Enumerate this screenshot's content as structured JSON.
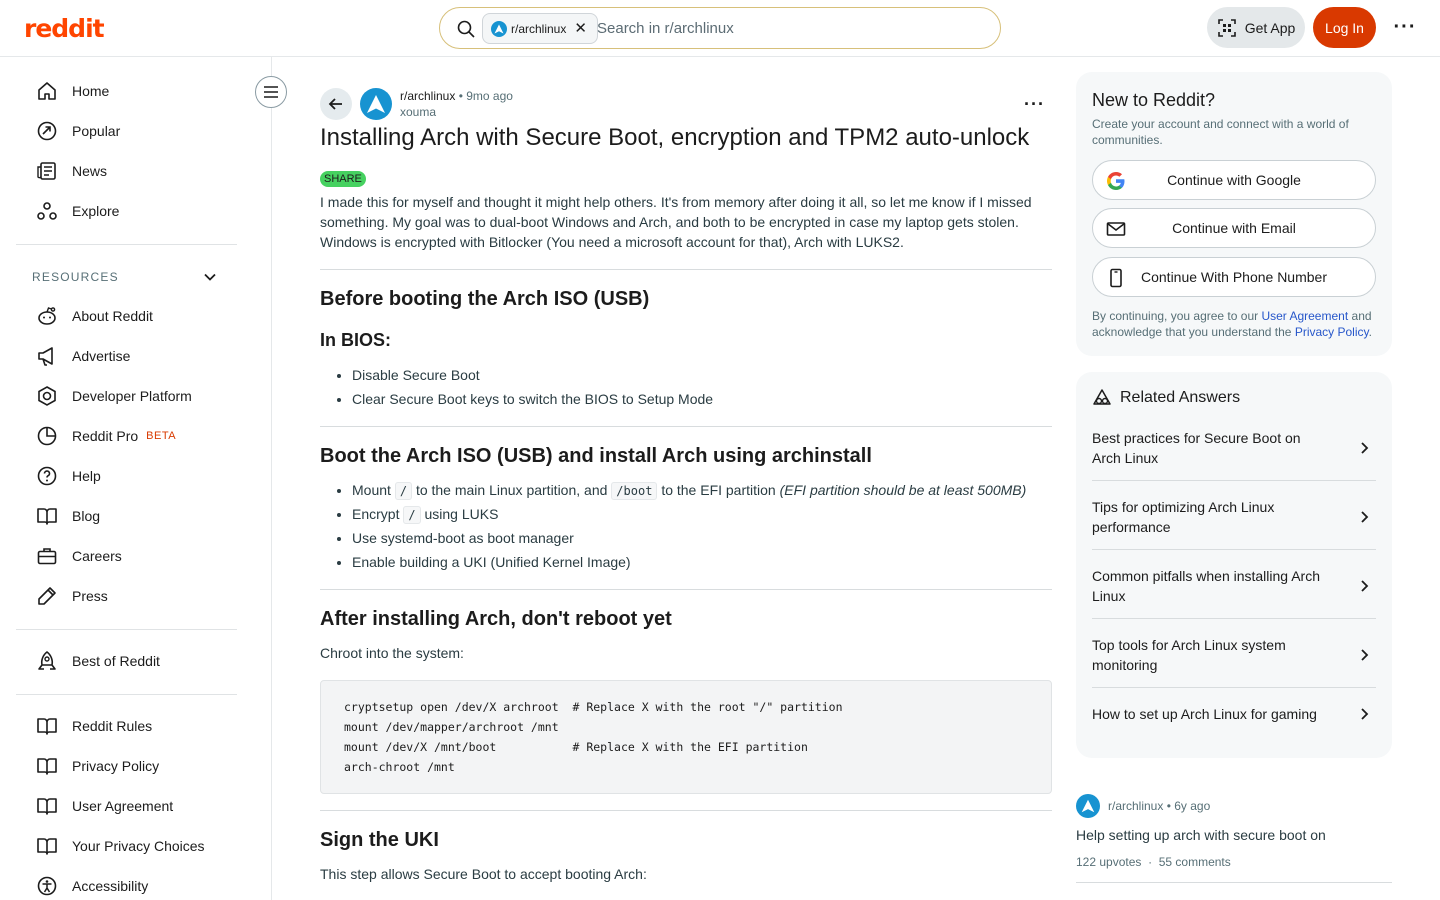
{
  "header": {
    "logo_text": "reddit",
    "search_chip": "r/archlinux",
    "search_placeholder": "Search in r/archlinux",
    "get_app": "Get App",
    "login": "Log In"
  },
  "sidebar": {
    "primary": [
      {
        "label": "Home",
        "icon": "home-icon"
      },
      {
        "label": "Popular",
        "icon": "popular-icon"
      },
      {
        "label": "News",
        "icon": "news-icon"
      },
      {
        "label": "Explore",
        "icon": "explore-icon"
      }
    ],
    "resources_label": "RESOURCES",
    "resources": [
      {
        "label": "About Reddit",
        "icon": "reddit-alien-icon"
      },
      {
        "label": "Advertise",
        "icon": "megaphone-icon"
      },
      {
        "label": "Developer Platform",
        "icon": "developer-icon"
      },
      {
        "label": "Reddit Pro",
        "icon": "pro-icon",
        "badge": "BETA"
      },
      {
        "label": "Help",
        "icon": "help-icon"
      },
      {
        "label": "Blog",
        "icon": "book-icon"
      },
      {
        "label": "Careers",
        "icon": "briefcase-icon"
      },
      {
        "label": "Press",
        "icon": "press-icon"
      }
    ],
    "best_of": {
      "label": "Best of Reddit",
      "icon": "best-of-icon"
    },
    "policies": [
      {
        "label": "Reddit Rules",
        "icon": "book-icon"
      },
      {
        "label": "Privacy Policy",
        "icon": "book-icon"
      },
      {
        "label": "User Agreement",
        "icon": "book-icon"
      },
      {
        "label": "Your Privacy Choices",
        "icon": "book-icon"
      },
      {
        "label": "Accessibility",
        "icon": "accessibility-icon"
      }
    ]
  },
  "post": {
    "subreddit": "r/archlinux",
    "time": "9mo ago",
    "author": "xouma",
    "title": "Installing Arch with Secure Boot, encryption and TPM2 auto-unlock",
    "flair": "SHARE",
    "intro": "I made this for myself and thought it might help others. It's from memory after doing it all, so let me know if I missed something. My goal was to dual-boot Windows and Arch, and both to be encrypted in case my laptop gets stolen. Windows is encrypted with Bitlocker (You need a microsoft account for that), Arch with LUKS2.",
    "s1_heading": "Before booting the Arch ISO (USB)",
    "s1_sub": "In BIOS:",
    "s1_items": [
      "Disable Secure Boot",
      "Clear Secure Boot keys to switch the BIOS to Setup Mode"
    ],
    "s2_heading": "Boot the Arch ISO (USB) and install Arch using archinstall",
    "s2_item1": {
      "a": "Mount",
      "c1": "/",
      "b": "to the main Linux partition, and",
      "c2": "/boot",
      "d": "to the EFI partition",
      "em": "(EFI partition should be at least 500MB)"
    },
    "s2_item2": {
      "a": "Encrypt",
      "c1": "/",
      "b": "using LUKS"
    },
    "s2_item3": "Use systemd-boot as boot manager",
    "s2_item4": "Enable building a UKI (Unified Kernel Image)",
    "s3_heading": "After installing Arch, don't reboot yet",
    "s3_text": "Chroot into the system:",
    "code_lines": [
      "cryptsetup open /dev/X archroot  # Replace X with the root \"/\" partition",
      "mount /dev/mapper/archroot /mnt",
      "mount /dev/X /mnt/boot           # Replace X with the EFI partition",
      "arch-chroot /mnt"
    ],
    "s4_heading": "Sign the UKI",
    "s4_text": "This step allows Secure Boot to accept booting Arch:"
  },
  "signup": {
    "title": "New to Reddit?",
    "subtitle": "Create your account and connect with a world of communities.",
    "google": "Continue with Google",
    "email": "Continue with Email",
    "phone": "Continue With Phone Number",
    "legal_a": "By continuing, you agree to our",
    "legal_link1": "User Agreement",
    "legal_b": "and acknowledge that you understand the",
    "legal_link2": "Privacy Policy",
    "legal_c": "."
  },
  "related_answers": {
    "title": "Related Answers",
    "items": [
      "Best practices for Secure Boot on Arch Linux",
      "Tips for optimizing Arch Linux performance",
      "Common pitfalls when installing Arch Linux",
      "Top tools for Arch Linux system monitoring",
      "How to set up Arch Linux for gaming"
    ]
  },
  "related_post": {
    "subreddit": "r/archlinux",
    "time": "6y ago",
    "title": "Help setting up arch with secure boot on",
    "upvotes": "122 upvotes",
    "comments": "55 comments"
  },
  "colors": {
    "brand": "#ff4500",
    "login": "#d93900",
    "flair": "#46d160",
    "link": "#2757ca"
  }
}
